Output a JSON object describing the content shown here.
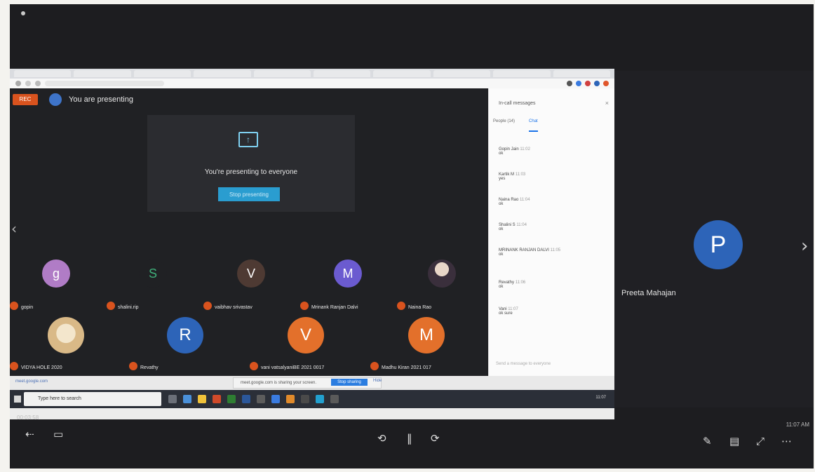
{
  "presenter": {
    "initial": "P",
    "name": "Preeta Mahajan"
  },
  "meet": {
    "rec_label": "REC",
    "presenting_status": "You are presenting",
    "present_title": "You're presenting to everyone",
    "stop_button": "Stop presenting",
    "participants": [
      {
        "initial": "g",
        "name": "gopin",
        "color": "#b07cc6"
      },
      {
        "initial": "S",
        "name": "shalini.rip",
        "color": "#202124"
      },
      {
        "initial": "V",
        "name": "vaibhav srivastav",
        "color": "#4e3a33"
      },
      {
        "initial": "M",
        "name": "Mrinank Ranjan Dalvi",
        "color": "#6b5bd0"
      },
      {
        "initial": "",
        "name": "Naina Rao",
        "color": "#8b8fb0"
      },
      {
        "initial": "",
        "name": "VIDYA HOLE 2020",
        "color": "#c59a5c"
      },
      {
        "initial": "R",
        "name": "Revathy",
        "color": "#2d64b8"
      },
      {
        "initial": "V",
        "name": "vani vatsalyaniBE 2021 0017",
        "color": "#e3702b"
      },
      {
        "initial": "M",
        "name": "Madhu Kiran 2021 017",
        "color": "#e3702b"
      }
    ]
  },
  "chat": {
    "title": "In-call messages",
    "close": "×",
    "tabs": [
      "People (14)",
      "",
      "Chat"
    ],
    "messages": [
      {
        "author": "Gopin Jain",
        "time": "11:02",
        "text": "ok"
      },
      {
        "author": "Kartik M",
        "time": "11:03",
        "text": "yes"
      },
      {
        "author": "Naina Rao",
        "time": "11:04",
        "text": "ok"
      },
      {
        "author": "Shalini S",
        "time": "11:04",
        "text": "ok"
      },
      {
        "author": "MRINANK RANJAN DALVI",
        "time": "11:05",
        "text": "ok"
      },
      {
        "author": "Revathy",
        "time": "11:06",
        "text": "ok"
      },
      {
        "author": "Vani",
        "time": "11:07",
        "text": "ok sure"
      }
    ],
    "input_placeholder": "Send a message to everyone"
  },
  "sharebar": {
    "tab_label": "meet.google.com",
    "message": "meet.google.com is sharing your screen.",
    "stop": "Stop sharing",
    "hide": "Hide"
  },
  "taskbar": {
    "search": "Type here to search",
    "clock": "11:07"
  },
  "footer": {
    "time_left": "00:03:58",
    "time_right": "11:07 AM"
  },
  "colors": {
    "accent": "#2a9dd0",
    "rec": "#d9531e"
  }
}
